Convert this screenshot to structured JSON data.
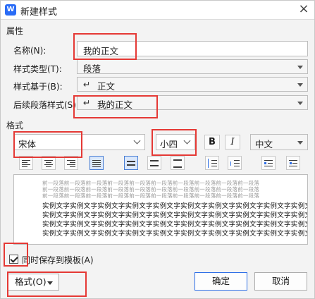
{
  "window": {
    "title": "新建样式",
    "app_icon": "W"
  },
  "properties": {
    "section_label": "属性",
    "name_label": "名称(N):",
    "name_value": "我的正文",
    "type_label": "样式类型(T):",
    "type_value": "段落",
    "based_on_label": "样式基于(B):",
    "based_on_value": "正文",
    "next_label": "后续段落样式(S):",
    "next_value": "我的正文",
    "paragraph_mark": "↵"
  },
  "format": {
    "section_label": "格式",
    "font_value": "宋体",
    "size_value": "小四",
    "bold_label": "B",
    "italic_label": "I",
    "language_value": "中文"
  },
  "preview": {
    "previous_paragraph_lines": [
      "前一段落前一段落前一段落前一段落前一段落前一段落前一段落前一段落前一段落前一段落",
      "前一段落前一段落前一段落前一段落前一段落前一段落前一段落前一段落前一段落前一段落",
      "前一段落前一段落前一段落前一段落前一段落前一段落前一段落前一段落前一段落前一段落"
    ],
    "sample_lines": [
      "实例文字实例文字实例文字实例文字实例文字实例文字实例文字实例文字实例文字实例文字",
      "实例文字实例文字实例文字实例文字实例文字实例文字实例文字实例文字实例文字实例文字",
      "实例文字实例文字实例文字实例文字实例文字实例文字实例文字实例文字实例文字实例文字",
      "实例文字实例文字实例文字实例文字实例文字实例文字实例文字实例文字实例文字实例文字"
    ]
  },
  "footer": {
    "save_to_template_label": "同时保存到模板(A)",
    "save_to_template_checked": true,
    "format_button_label": "格式(O)",
    "ok_label": "确定",
    "cancel_label": "取消"
  },
  "colors": {
    "highlight_box": "#e53935",
    "accent": "#2d6ee6"
  }
}
